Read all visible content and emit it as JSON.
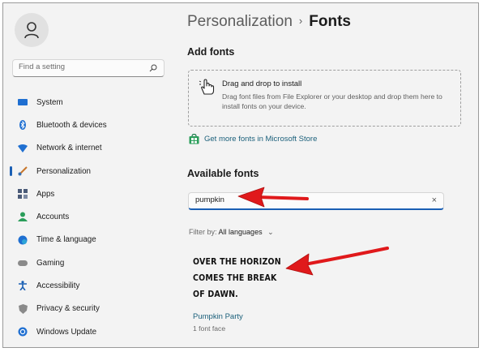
{
  "sidebar": {
    "search_placeholder": "Find a setting",
    "items": [
      {
        "label": "System",
        "icon": "monitor-icon",
        "color": "#1f6fd1"
      },
      {
        "label": "Bluetooth & devices",
        "icon": "bluetooth-icon",
        "color": "#1f6fd1"
      },
      {
        "label": "Network & internet",
        "icon": "wifi-icon",
        "color": "#1f6fd1"
      },
      {
        "label": "Personalization",
        "icon": "brush-icon",
        "color": "#c8762b",
        "active": true
      },
      {
        "label": "Apps",
        "icon": "apps-icon",
        "color": "#4a5a78"
      },
      {
        "label": "Accounts",
        "icon": "person-icon",
        "color": "#2a9d5a"
      },
      {
        "label": "Time & language",
        "icon": "globe-clock-icon",
        "color": "#1f6fd1"
      },
      {
        "label": "Gaming",
        "icon": "gamepad-icon",
        "color": "#7a7a7a"
      },
      {
        "label": "Accessibility",
        "icon": "accessibility-icon",
        "color": "#1a5fb4"
      },
      {
        "label": "Privacy & security",
        "icon": "shield-icon",
        "color": "#7a7a7a"
      },
      {
        "label": "Windows Update",
        "icon": "sync-icon",
        "color": "#1f6fd1"
      }
    ]
  },
  "breadcrumb": {
    "parent": "Personalization",
    "separator": "›",
    "current": "Fonts"
  },
  "add_fonts": {
    "heading": "Add fonts",
    "drop_title": "Drag and drop to install",
    "drop_desc": "Drag font files from File Explorer or your desktop and drop them here to install fonts on your device.",
    "store_link": "Get more fonts in Microsoft Store"
  },
  "available": {
    "heading": "Available fonts",
    "search_value": "pumpkin",
    "clear_glyph": "×",
    "filter_label": "Filter by:",
    "filter_value": "All languages",
    "font": {
      "preview_line1": "Over the horizon",
      "preview_line2": "comes the break",
      "preview_line3": "of dawn.",
      "name": "Pumpkin Party",
      "faces": "1 font face"
    }
  },
  "colors": {
    "accent": "#1a5fb4",
    "link": "#1a5f7a",
    "arrow": "#e0191b"
  }
}
